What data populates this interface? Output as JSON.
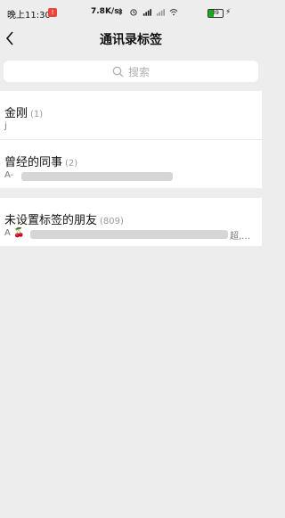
{
  "status_bar": {
    "time": "晚上11:30",
    "notification": "!",
    "net_speed": "7.8K/s",
    "battery": "39"
  },
  "nav": {
    "title": "通讯录标签"
  },
  "search": {
    "placeholder": "搜索"
  },
  "groups": [
    {
      "name": "金刚",
      "count": "(1)",
      "members": "j"
    },
    {
      "name": "曾经的同事",
      "count": "(2)",
      "members": "A-"
    },
    {
      "name": "未设置标签的朋友",
      "count": "(809)",
      "members": "A 🍒",
      "members_tail": "超,…"
    }
  ]
}
